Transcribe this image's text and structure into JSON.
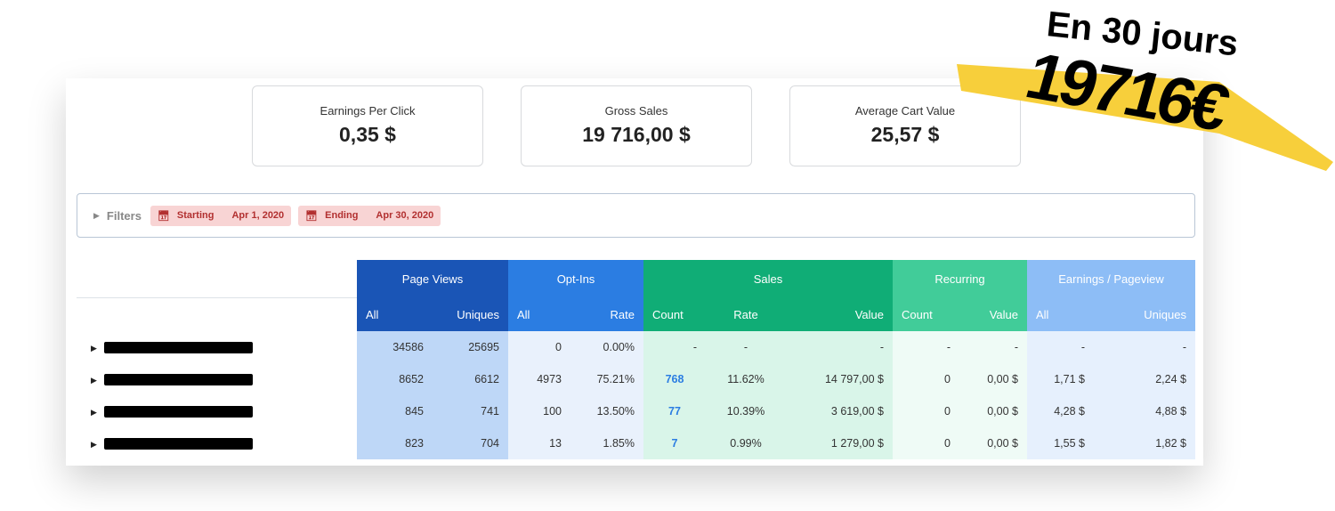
{
  "promo": {
    "line1": "En 30 jours",
    "line2": "19716€",
    "stroke_color": "#f7cf3b"
  },
  "cards": [
    {
      "label": "Earnings Per Click",
      "value": "0,35 $"
    },
    {
      "label": "Gross Sales",
      "value": "19 716,00 $"
    },
    {
      "label": "Average Cart Value",
      "value": "25,57 $"
    }
  ],
  "filters": {
    "label": "Filters",
    "start_label": "Starting",
    "start_value": "Apr 1, 2020",
    "end_label": "Ending",
    "end_value": "Apr 30, 2020"
  },
  "table": {
    "groups": [
      "Page Views",
      "Opt-Ins",
      "Sales",
      "Recurring",
      "Earnings / Pageview"
    ],
    "subheaders": [
      "All",
      "Uniques",
      "All",
      "Rate",
      "Count",
      "Rate",
      "Value",
      "Count",
      "Value",
      "All",
      "Uniques"
    ],
    "rows": [
      [
        "34586",
        "25695",
        "0",
        "0.00%",
        "-",
        "-",
        "-",
        "-",
        "-",
        "-",
        "-"
      ],
      [
        "8652",
        "6612",
        "4973",
        "75.21%",
        "768",
        "11.62%",
        "14 797,00 $",
        "0",
        "0,00 $",
        "1,71 $",
        "2,24 $"
      ],
      [
        "845",
        "741",
        "100",
        "13.50%",
        "77",
        "10.39%",
        "3 619,00 $",
        "0",
        "0,00 $",
        "4,28 $",
        "4,88 $"
      ],
      [
        "823",
        "704",
        "13",
        "1.85%",
        "7",
        "0.99%",
        "1 279,00 $",
        "0",
        "0,00 $",
        "1,55 $",
        "1,82 $"
      ]
    ]
  }
}
